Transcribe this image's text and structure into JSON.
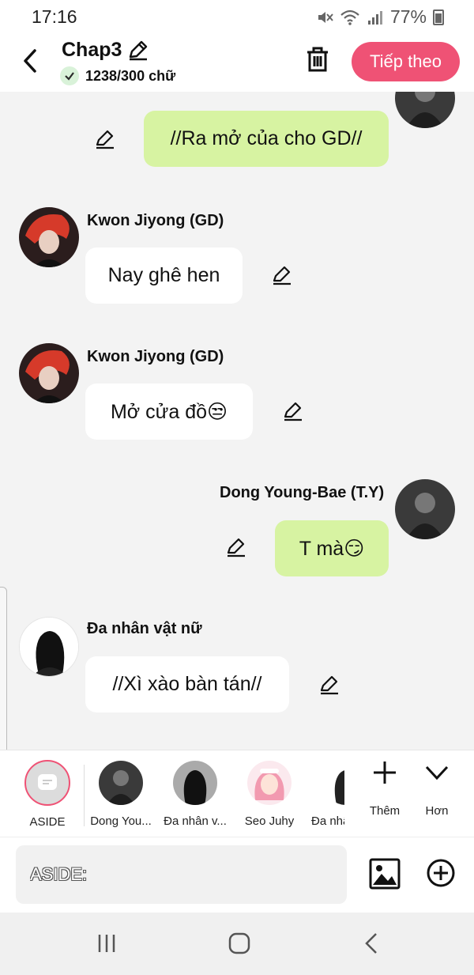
{
  "status": {
    "time": "17:16",
    "battery": "77%"
  },
  "header": {
    "title": "Chap3",
    "word_count": "1238/300 chữ",
    "next_label": "Tiếp theo"
  },
  "messages": [
    {
      "side": "right",
      "text": "//Ra mở của cho GD//"
    },
    {
      "side": "left",
      "name": "Kwon Jiyong (GD)",
      "text": "Nay ghê hen"
    },
    {
      "side": "left",
      "name": "Kwon Jiyong (GD)",
      "text": "Mở cửa đồ😒"
    },
    {
      "side": "right",
      "name": "Dong Young-Bae (T.Y)",
      "text": "T mà😏"
    },
    {
      "side": "left",
      "name": "Đa nhân vật nữ",
      "text": "//Xì xào bàn tán//"
    }
  ],
  "characters": [
    {
      "label": "ASIDE"
    },
    {
      "label": "Dong You..."
    },
    {
      "label": "Đa nhân v..."
    },
    {
      "label": "Seo Juhy"
    },
    {
      "label": "Đa nhâ"
    }
  ],
  "tools": {
    "add_label": "Thêm",
    "more_label": "Hơn"
  },
  "input": {
    "placeholder": "ASIDE:"
  },
  "colors": {
    "accent": "#ef5275",
    "bubble_right": "#d7f3a2",
    "bubble_left": "#ffffff",
    "background": "#f3f3f3"
  }
}
